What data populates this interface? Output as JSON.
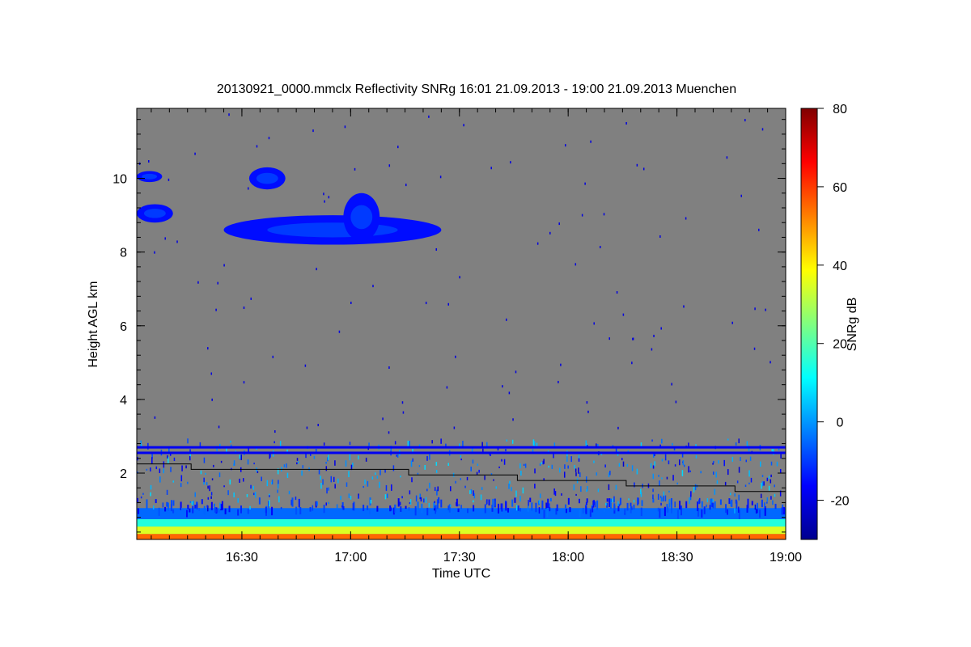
{
  "chart_data": {
    "type": "heatmap",
    "title": "20130921_0000.mmclx Reflectivity SNRg   16:01 21.09.2013 - 19:00 21.09.2013 Muenchen",
    "xlabel": "Time UTC",
    "ylabel": "Height AGL km",
    "x_range": [
      "16:01",
      "19:00"
    ],
    "x_ticks": [
      "16:30",
      "17:00",
      "17:30",
      "18:00",
      "18:30",
      "19:00"
    ],
    "y_range": [
      0.2,
      11.9
    ],
    "y_ticks": [
      2,
      4,
      6,
      8,
      10
    ],
    "grid": false,
    "background_color": "#808080",
    "colorbar": {
      "label": "SNRg dB",
      "range": [
        -30,
        80
      ],
      "ticks": [
        -20,
        0,
        20,
        40,
        60,
        80
      ],
      "colormap": "jet"
    },
    "overlay_line": {
      "description": "stepped black line (cloud base / threshold)",
      "points": [
        [
          "16:01",
          2.25
        ],
        [
          "16:16",
          2.25
        ],
        [
          "16:16",
          2.1
        ],
        [
          "17:16",
          2.1
        ],
        [
          "17:16",
          1.95
        ],
        [
          "17:46",
          1.95
        ],
        [
          "17:46",
          1.8
        ],
        [
          "18:16",
          1.8
        ],
        [
          "18:16",
          1.65
        ],
        [
          "18:46",
          1.65
        ],
        [
          "18:46",
          1.5
        ],
        [
          "19:00",
          1.5
        ]
      ]
    },
    "features": {
      "cirrus_upper": [
        {
          "t_start": "16:01",
          "t_end": "16:08",
          "h_low": 9.9,
          "h_high": 10.2
        },
        {
          "t_start": "16:01",
          "t_end": "16:11",
          "h_low": 8.8,
          "h_high": 9.3
        },
        {
          "t_start": "16:32",
          "t_end": "16:42",
          "h_low": 9.7,
          "h_high": 10.3
        },
        {
          "t_start": "16:25",
          "t_end": "17:25",
          "h_low": 8.2,
          "h_high": 9.0
        },
        {
          "t_start": "16:58",
          "t_end": "17:08",
          "h_low": 8.3,
          "h_high": 9.6
        }
      ],
      "cirrus_snr_db": -15,
      "horizontal_bands_km": [
        2.55,
        2.7
      ],
      "boundary_layer": [
        {
          "h_low": 0.2,
          "h_high": 0.35,
          "snr_db": 55
        },
        {
          "h_low": 0.35,
          "h_high": 0.55,
          "snr_db": 35
        },
        {
          "h_low": 0.55,
          "h_high": 0.75,
          "snr_db": 15
        },
        {
          "h_low": 0.75,
          "h_high": 1.05,
          "snr_db": -5
        }
      ]
    }
  }
}
